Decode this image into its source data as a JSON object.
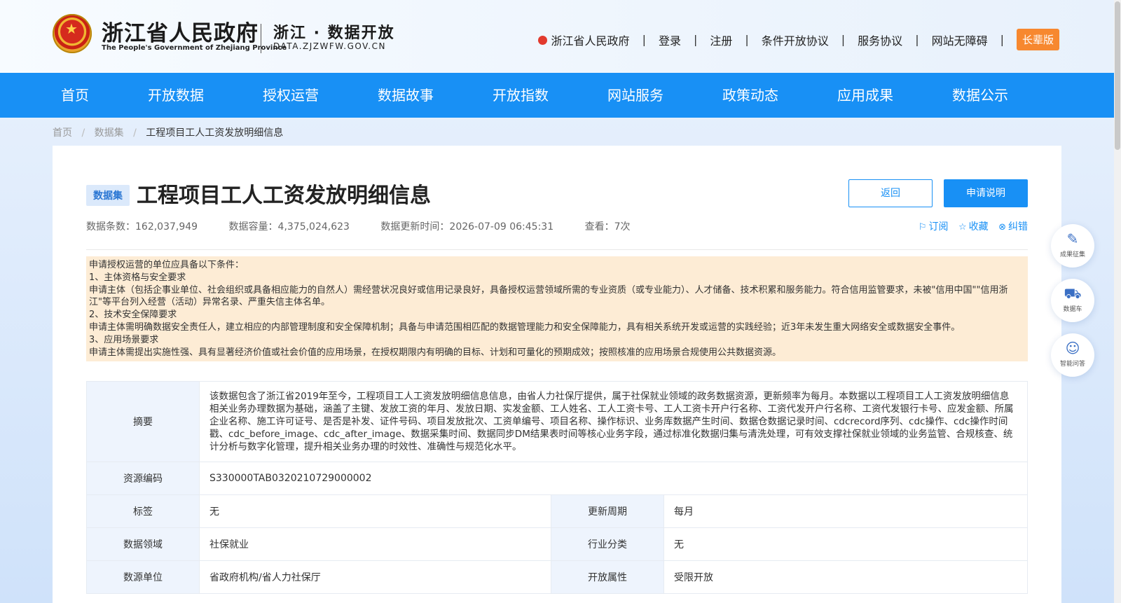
{
  "header": {
    "gov_name_cn": "浙江省人民政府",
    "gov_name_en": "The People's Government of Zhejiang Province",
    "portal_name": "浙江 · 数据开放",
    "portal_url": "DATA.ZJZWFW.GOV.CN",
    "links": {
      "gov": "浙江省人民政府",
      "login": "登录",
      "register": "注册",
      "conditional_agreement": "条件开放协议",
      "service_agreement": "服务协议",
      "accessibility": "网站无障碍",
      "elder_mode": "长辈版"
    },
    "separator": "|"
  },
  "nav": [
    "首页",
    "开放数据",
    "授权运营",
    "数据故事",
    "开放指数",
    "网站服务",
    "政策动态",
    "应用成果",
    "数据公示"
  ],
  "breadcrumb": {
    "home": "首页",
    "datasets": "数据集",
    "current": "工程项目工人工资发放明细信息",
    "separator": "/"
  },
  "dataset": {
    "tag": "数据集",
    "title": "工程项目工人工资发放明细信息",
    "back_label": "返回",
    "apply_label": "申请说明",
    "stats": {
      "records": "数据条数：162,037,949",
      "capacity": "数据容量：4,375,024,623",
      "updated": "数据更新时间：2026-07-09 06:45:31",
      "views": "查看：7次"
    },
    "actions": {
      "subscribe": "订阅",
      "favorite": "收藏",
      "report": "纠错"
    }
  },
  "notice": [
    "申请授权运营的单位应具备以下条件：",
    "1、主体资格与安全要求",
    "申请主体（包括企事业单位、社会组织或具备相应能力的自然人）需经营状况良好或信用记录良好，具备授权运营领域所需的专业资质（或专业能力）、人才储备、技术积累和服务能力。符合信用监管要求，未被\"信用中国\"\"信用浙江\"等平台列入经营（活动）异常名录、严重失信主体名单。",
    "2、技术安全保障要求",
    "申请主体需明确数据安全责任人，建立相应的内部管理制度和安全保障机制；具备与申请范围相匹配的数据管理能力和安全保障能力，具有相关系统开发或运营的实践经验；近3年未发生重大网络安全或数据安全事件。",
    "3、应用场景要求",
    "申请主体需提出实施性强、具有显著经济价值或社会价值的应用场景，在授权期限内有明确的目标、计划和可量化的预期成效；按照核准的应用场景合规使用公共数据资源。"
  ],
  "info": {
    "summary_label": "摘要",
    "summary": "该数据包含了浙江省2019年至今，工程项目工人工资发放明细信息信息，由省人力社保厅提供，属于社保就业领域的政务数据资源，更新频率为每月。本数据以工程项目工人工资发放明细信息相关业务办理数据为基础，涵盖了主键、发放工资的年月、发放日期、实发金额、工人姓名、工人工资卡号、工人工资卡开户行名称、工资代发开户行名称、工资代发银行卡号、应发金额、所属企业名称、施工许可证号、是否是补发、证件号码、项目发放批次、工资单编号、项目名称、操作标识、业务库数据产生时间、数据仓数据记录时间、cdcrecord序列、cdc操作、cdc操作时间戳、cdc_before_image、cdc_after_image、数据采集时间、数据同步DM结果表时间等核心业务字段，通过标准化数据归集与清洗处理，可有效支撑社保就业领域的业务监管、合规核查、统计分析与数字化管理，提升相关业务办理的时效性、准确性与规范化水平。",
    "code_label": "资源编码",
    "code": "S330000TAB0320210729000002",
    "tags_label": "标签",
    "tags": "无",
    "cycle_label": "更新周期",
    "cycle": "每月",
    "domain_label": "数据领域",
    "domain": "社保就业",
    "industry_label": "行业分类",
    "industry": "无",
    "source_label": "数源单位",
    "source": "省政府机构/省人力社保厅",
    "open_label": "开放属性",
    "open": "受限开放"
  },
  "side_tools": {
    "results": "成果征集",
    "cart": "数据车",
    "qa": "智能问答"
  },
  "colors": {
    "primary": "#1890f5",
    "elder_button": "#f7882f",
    "notice_bg": "#fdecd5",
    "label_bg": "#eef4fd"
  }
}
